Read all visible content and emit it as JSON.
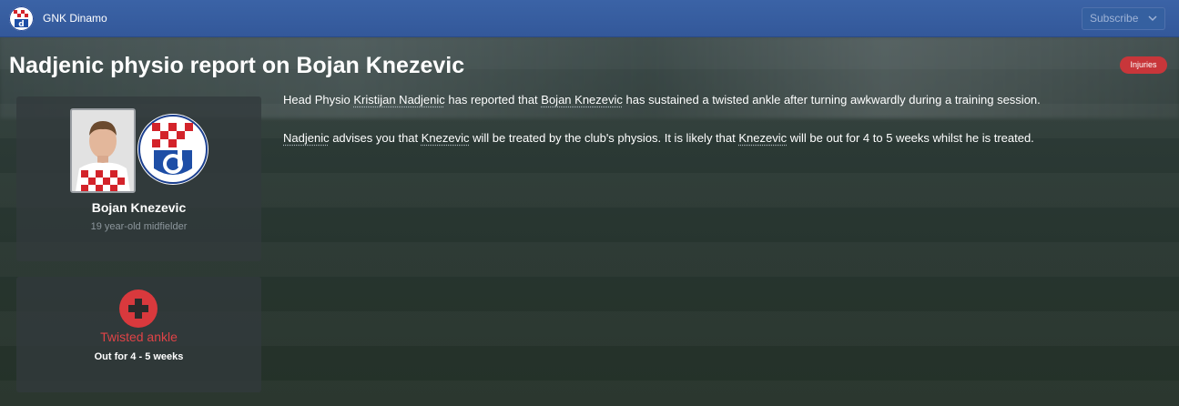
{
  "header": {
    "club_name": "GNK Dinamo",
    "subscribe_label": "Subscribe",
    "subscribe_icon": "chevron-down-icon"
  },
  "title": "Nadjenic physio report on Bojan Knezevic",
  "badge": "Injuries",
  "player": {
    "name": "Bojan Knezevic",
    "description": "19 year-old midfielder"
  },
  "injury": {
    "icon": "medical-cross-icon",
    "title": "Twisted ankle",
    "duration": "Out for 4 - 5 weeks"
  },
  "report": {
    "p1": {
      "t1": "Head Physio ",
      "link1": "Kristijan Nadjenic",
      "t2": " has reported that ",
      "link2": "Bojan Knezevic",
      "t3": " has sustained a twisted ankle after turning awkwardly during a training session."
    },
    "p2": {
      "link1": "Nadjenic",
      "t1": " advises you that ",
      "link2": "Knezevic",
      "t2": " will be treated by the club's physios. It is likely that ",
      "link3": "Knezevic",
      "t3": " will be out for 4 to 5 weeks whilst he is treated."
    }
  },
  "colors": {
    "topbar": "#3b63a6",
    "badge": "#c8363a",
    "injury_accent": "#d9393d"
  }
}
